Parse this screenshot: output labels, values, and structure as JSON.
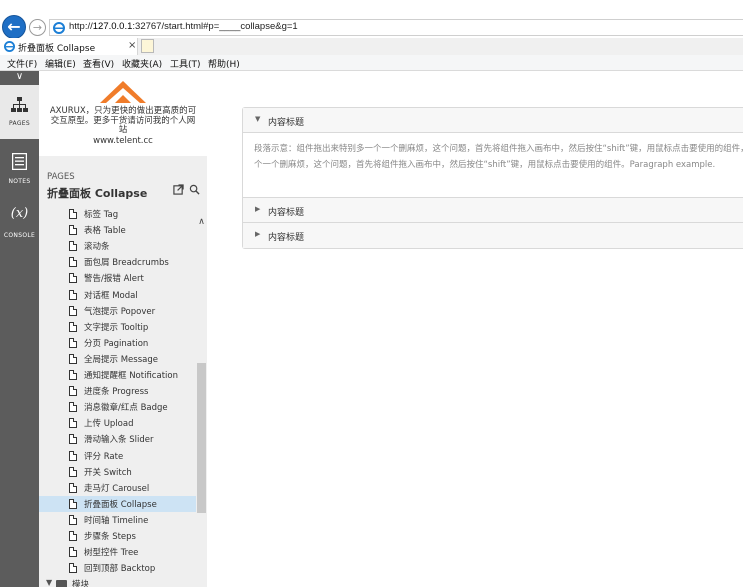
{
  "browser": {
    "url_prefix": "http://",
    "url_host": "127.0.0.1",
    "url_rest": ":32767/start.html#p=____collapse&g=1",
    "tab_title": "折叠面板 Collapse",
    "tab_close": "×",
    "menu": [
      "文件(F)",
      "编辑(E)",
      "查看(V)",
      "收藏夹(A)",
      "工具(T)",
      "帮助(H)"
    ]
  },
  "rail": {
    "collapse_glyph": "∨",
    "items": [
      {
        "label": "PAGES",
        "icon": "sitemap-icon",
        "glyph": "品"
      },
      {
        "label": "NOTES",
        "icon": "notes-icon",
        "glyph": "▤"
      },
      {
        "label": "CONSOLE",
        "icon": "console-icon",
        "glyph": "(x)"
      }
    ]
  },
  "panel": {
    "brand": "AXURUX",
    "tagline": "AXURUX，只为更快的做出更高质的可交互原型。更多干货请访问我的个人网站",
    "site": "www.telent.cc",
    "pages_label": "PAGES",
    "current_page": "折叠面板 Collapse",
    "tree": [
      "标签 Tag",
      "表格 Table",
      "滚动条",
      "面包屑 Breadcrumbs",
      "警告/报错 Alert",
      "对话框 Modal",
      "气泡提示 Popover",
      "文字提示 Tooltip",
      "分页 Pagination",
      "全局提示 Message",
      "通知提醒框 Notification",
      "进度条 Progress",
      "消息徽章/红点 Badge",
      "上传 Upload",
      "滑动输入条 Slider",
      "评分 Rate",
      "开关 Switch",
      "走马灯 Carousel",
      "折叠面板 Collapse",
      "时间轴 Timeline",
      "步骤条 Steps",
      "树型控件 Tree",
      "回到顶部 Backtop"
    ],
    "active_index": 18,
    "folder_label": "模块"
  },
  "collapse": {
    "panels": [
      {
        "title": "内容标题",
        "expanded": true,
        "body": "段落示意：组件拖出来特别多一个一个删麻烦，这个问题，首先将组件拖入画布中，然后按住“shift”键，用鼠标点击要使用的组件，Paragraph example.段落示意：组件拖出来特别多一个一个删麻烦，这个问题，首先将组件拖入画布中，然后按住“shift”键，用鼠标点击要使用的组件。Paragraph example."
      },
      {
        "title": "内容标题",
        "expanded": false
      },
      {
        "title": "内容标题",
        "expanded": false
      }
    ]
  },
  "colors": {
    "active_row": "#cde3f4",
    "rail": "#5c5c5c",
    "logo": "#f07c2a"
  }
}
